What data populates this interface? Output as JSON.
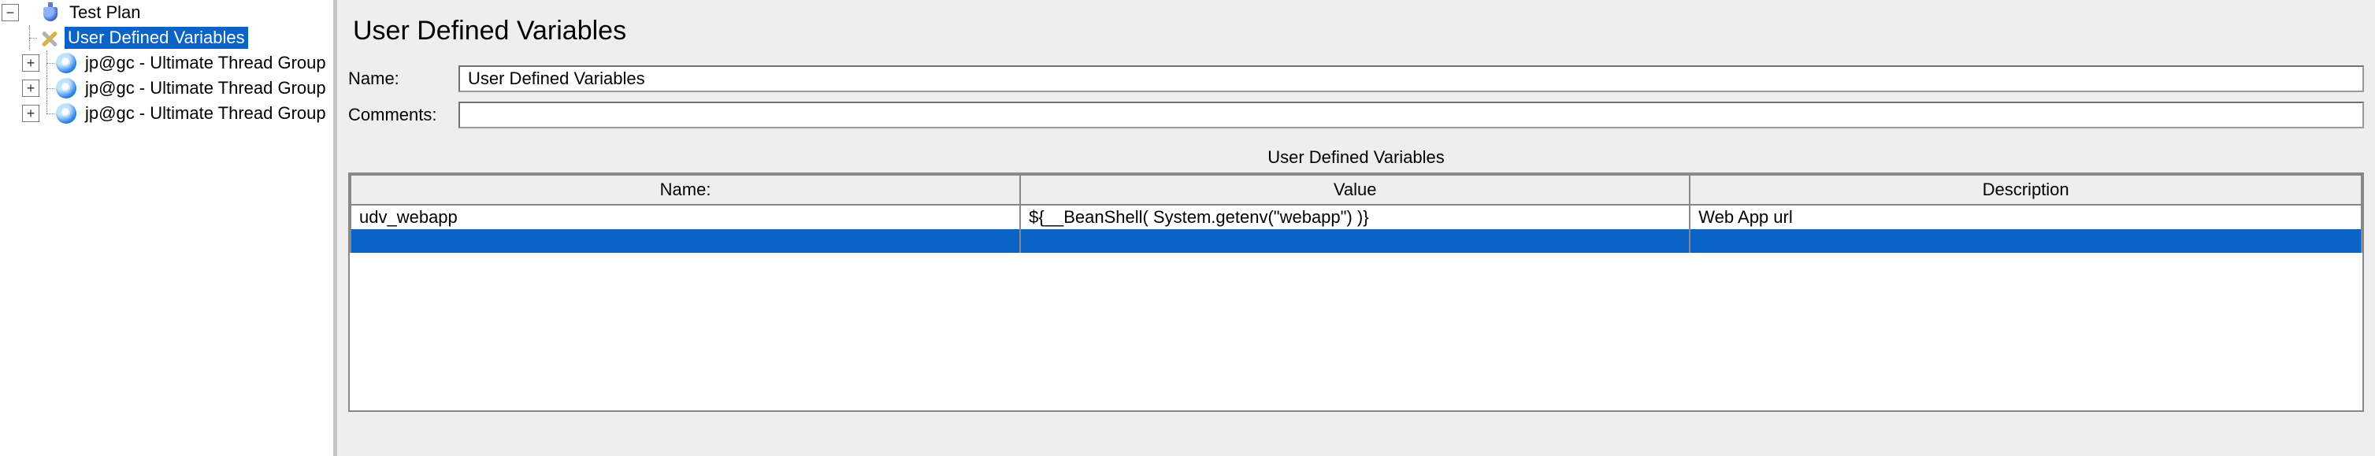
{
  "tree": {
    "root_label": "Test Plan",
    "nodes": [
      {
        "label": "User Defined Variables",
        "selected": true,
        "icon": "tools"
      },
      {
        "label": "jp@gc - Ultimate Thread Group",
        "selected": false,
        "icon": "gear",
        "expandable": true
      },
      {
        "label": "jp@gc - Ultimate Thread Group",
        "selected": false,
        "icon": "gear",
        "expandable": true
      },
      {
        "label": "jp@gc - Ultimate Thread Group",
        "selected": false,
        "icon": "gear",
        "expandable": true
      }
    ]
  },
  "panel": {
    "title": "User Defined Variables",
    "name_label": "Name:",
    "name_value": "User Defined Variables",
    "comments_label": "Comments:",
    "comments_value": "",
    "table_title": "User Defined Variables",
    "columns": {
      "name": "Name:",
      "value": "Value",
      "description": "Description"
    },
    "rows": [
      {
        "name": "udv_webapp",
        "value": "${__BeanShell( System.getenv(\"webapp\") )}",
        "description": "Web App url"
      }
    ]
  }
}
